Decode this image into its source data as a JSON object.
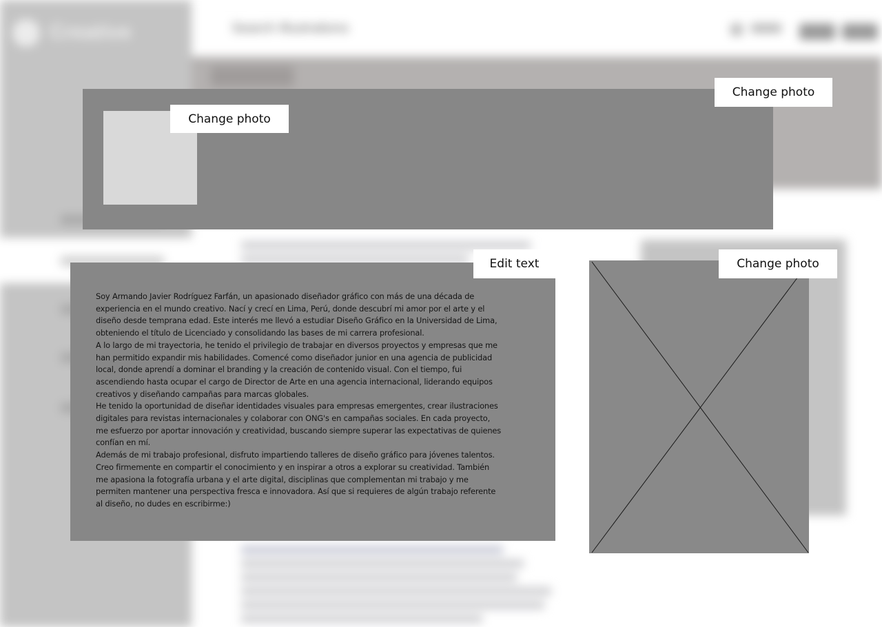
{
  "background": {
    "brand": "Creative",
    "search_placeholder": "Search Illustrations"
  },
  "overlays": {
    "avatar_change_label": "Change photo",
    "cover_change_label": "Change photo",
    "edit_text_label": "Edit text",
    "side_photo_change_label": "Change photo"
  },
  "bio": {
    "paragraphs": [
      "Soy Armando Javier Rodríguez Farfán, un apasionado diseñador gráfico con más de una década de experiencia en el mundo creativo. Nací y crecí en Lima, Perú, donde descubrí mi amor por el arte y el diseño desde temprana edad. Este interés me llevó a estudiar Diseño Gráfico en la Universidad de Lima, obteniendo el título de Licenciado y consolidando las bases de mi carrera profesional.",
      "A lo largo de mi trayectoria, he tenido el privilegio de trabajar en diversos proyectos y empresas que me han permitido expandir mis habilidades. Comencé como diseñador junior en una agencia de publicidad local, donde aprendí a dominar el branding y la creación de contenido visual. Con el tiempo, fui ascendiendo hasta ocupar el cargo de Director de Arte en una agencia internacional, liderando equipos creativos y diseñando campañas para marcas globales.",
      "He tenido la oportunidad de diseñar identidades visuales para empresas emergentes, crear ilustraciones digitales para revistas internacionales y colaborar con ONG's en campañas sociales. En cada proyecto, me esfuerzo por aportar innovación y creatividad, buscando siempre superar las expectativas de quienes confían en mí.",
      "Además de mi trabajo profesional, disfruto impartiendo talleres de diseño gráfico para jóvenes talentos. Creo firmemente en compartir el conocimiento y en inspirar a otros a explorar su creatividad. También me apasiona la fotografía urbana y el arte digital, disciplinas que complementan mi trabajo y me permiten mantener una perspectiva fresca e innovadora. Así que si requieres de algún trabajo referente al diseño, no dudes en escribirme:)"
    ]
  }
}
